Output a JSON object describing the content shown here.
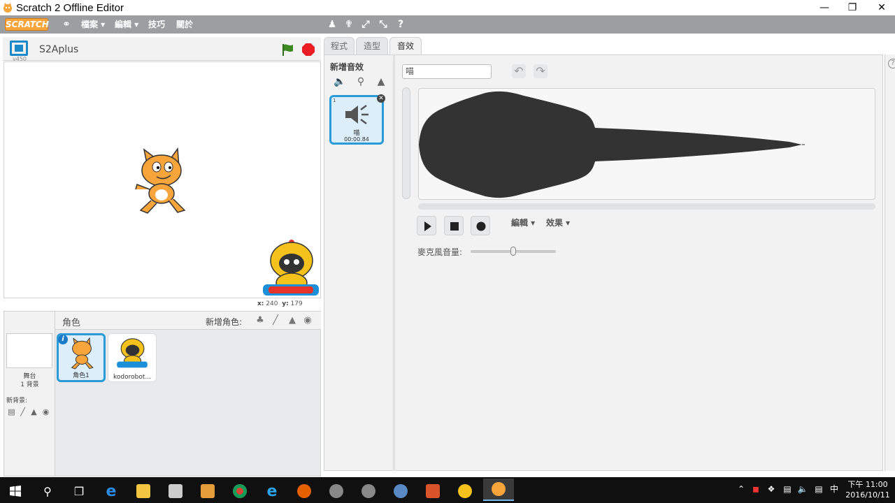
{
  "window": {
    "title": "Scratch 2 Offline Editor"
  },
  "menubar": {
    "logo": "SCRATCH",
    "items": [
      "檔案 ▾",
      "編輯 ▾",
      "技巧",
      "關於"
    ]
  },
  "stage": {
    "title": "S2Aplus",
    "version": "v450",
    "coords": {
      "x_label": "x:",
      "x": "240",
      "y_label": "y:",
      "y": "179"
    }
  },
  "sprites": {
    "header": "角色",
    "new_sprite": "新增角色:",
    "stage_label": "舞台",
    "backdrop_count": "1 背景",
    "new_backdrop": "新背景:",
    "items": [
      {
        "name": "角色1",
        "selected": true
      },
      {
        "name": "kodorobot...",
        "selected": false
      }
    ]
  },
  "tabs": [
    "程式",
    "造型",
    "音效"
  ],
  "sounds": {
    "new_sound": "新增音效",
    "list": [
      {
        "index": "1",
        "name": "喵",
        "duration": "00:00.84"
      }
    ]
  },
  "editor": {
    "sound_name": "喵",
    "edit_menu": "編輯 ▾",
    "effects_menu": "效果 ▾",
    "mic_volume_label": "麥克風音量:",
    "mic_volume": 0.5
  },
  "taskbar": {
    "time": "下午 11:00",
    "date": "2016/10/11",
    "ime": "中"
  },
  "colors": {
    "accent": "#2a9bd8",
    "menubar": "#9c9ea2",
    "logo": "#f7a43b"
  }
}
